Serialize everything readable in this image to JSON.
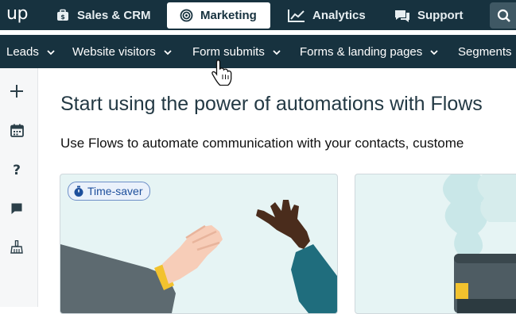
{
  "app": {
    "logo_text": "up",
    "top_tabs": [
      {
        "label": "Sales & CRM",
        "icon": "briefcase-icon"
      },
      {
        "label": "Marketing",
        "icon": "target-icon",
        "active": true
      },
      {
        "label": "Analytics",
        "icon": "chart-line-icon"
      },
      {
        "label": "Support",
        "icon": "chat-bubbles-icon"
      }
    ],
    "search_icon": "search-icon"
  },
  "subnav": {
    "items": [
      {
        "label": "Leads"
      },
      {
        "label": "Website visitors"
      },
      {
        "label": "Form submits"
      },
      {
        "label": "Forms & landing pages"
      },
      {
        "label": "Segments"
      }
    ]
  },
  "sidebar": {
    "icons": [
      "plus-icon",
      "calendar-icon",
      "help-icon",
      "chat-icon",
      "broom-icon"
    ]
  },
  "main": {
    "title": "Start using the power of automations with Flows",
    "subtitle": "Use Flows to automate communication with your contacts, custome",
    "cards": [
      {
        "badge": "Time-saver",
        "badge_icon": "stopwatch-icon",
        "illustration": "handshake-illustration"
      },
      {
        "illustration": "cloud-laptop-illustration"
      }
    ]
  },
  "colors": {
    "topbar_bg": "#17323f",
    "card_bg": "#e6f4f4",
    "badge_text": "#1d4f9c"
  }
}
